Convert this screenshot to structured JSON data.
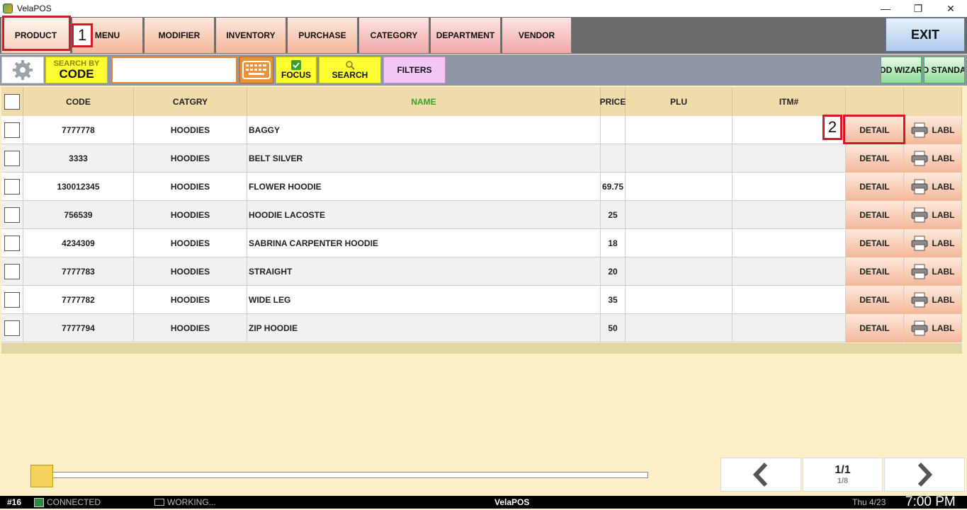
{
  "window": {
    "title": "VelaPOS"
  },
  "nav": {
    "tabs": [
      "PRODUCT",
      "MENU",
      "MODIFIER",
      "INVENTORY",
      "PURCHASE",
      "CATEGORY",
      "DEPARTMENT",
      "VENDOR"
    ],
    "exit_label": "EXIT"
  },
  "annotations": {
    "marker1": "1",
    "marker2": "2"
  },
  "toolbar": {
    "search_by_small": "SEARCH BY",
    "search_by_big": "CODE",
    "search_value": "",
    "focus_label": "FOCUS",
    "search_label": "SEARCH",
    "filters_label": "FILTERS",
    "add_wizard": "ADD WIZARD",
    "add_standard": "ADD STANDARD"
  },
  "table": {
    "headers": {
      "code": "CODE",
      "category": "CATGRY",
      "name": "NAME",
      "price": "PRICE",
      "plu": "PLU",
      "item": "ITM#"
    },
    "header_name_color": "#3aa02a",
    "detail_label": "DETAIL",
    "label_label": "LABL",
    "rows": [
      {
        "code": "7777778",
        "category": "HOODIES",
        "name": "BAGGY",
        "price": "",
        "plu": "",
        "item": ""
      },
      {
        "code": "3333",
        "category": "HOODIES",
        "name": "BELT SILVER",
        "price": "",
        "plu": "",
        "item": ""
      },
      {
        "code": "130012345",
        "category": "HOODIES",
        "name": "FLOWER HOODIE",
        "price": "69.75",
        "plu": "",
        "item": ""
      },
      {
        "code": "756539",
        "category": "HOODIES",
        "name": "HOODIE LACOSTE",
        "price": "25",
        "plu": "",
        "item": ""
      },
      {
        "code": "4234309",
        "category": "HOODIES",
        "name": "SABRINA CARPENTER HOODIE",
        "price": "18",
        "plu": "",
        "item": ""
      },
      {
        "code": "7777783",
        "category": "HOODIES",
        "name": "STRAIGHT",
        "price": "20",
        "plu": "",
        "item": ""
      },
      {
        "code": "7777782",
        "category": "HOODIES",
        "name": "WIDE LEG",
        "price": "35",
        "plu": "",
        "item": ""
      },
      {
        "code": "7777794",
        "category": "HOODIES",
        "name": "ZIP HOODIE",
        "price": "50",
        "plu": "",
        "item": ""
      }
    ]
  },
  "pager": {
    "page": "1/1",
    "count": "1/8"
  },
  "status": {
    "terminal": "#16",
    "connection": "CONNECTED",
    "working": "WORKING...",
    "app": "VelaPOS",
    "date": "Thu 4/23",
    "time": "7:00 PM"
  }
}
